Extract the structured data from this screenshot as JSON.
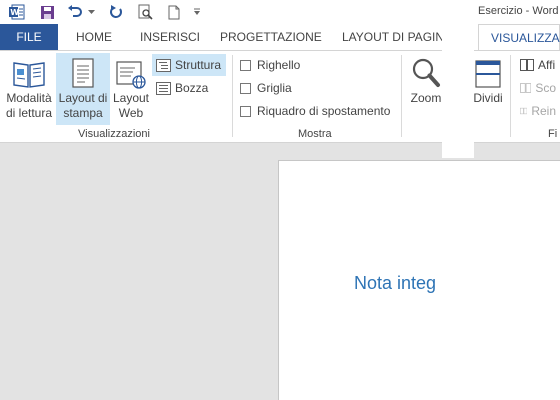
{
  "window": {
    "title": "Esercizio - Word"
  },
  "qat": {
    "icons": [
      "word-logo-icon",
      "save-icon",
      "undo-icon",
      "undo-dropdown-icon",
      "redo-icon",
      "print-preview-icon",
      "new-document-icon",
      "customize-qat-icon"
    ]
  },
  "tabs": {
    "file": "FILE",
    "home": "HOME",
    "insert": "INSERISCI",
    "design": "PROGETTAZIONE",
    "layout": "LAYOUT DI PAGINA",
    "view": "VISUALIZZA"
  },
  "ribbon": {
    "views": {
      "read_mode_line1": "Modalità",
      "read_mode_line2": "di lettura",
      "print_layout_line1": "Layout di",
      "print_layout_line2": "stampa",
      "web_layout_line1": "Layout",
      "web_layout_line2": "Web",
      "outline": "Struttura",
      "draft": "Bozza",
      "group_label": "Visualizzazioni"
    },
    "show": {
      "ruler": "Righello",
      "gridlines": "Griglia",
      "navigation_pane": "Riquadro di spostamento",
      "group_label": "Mostra"
    },
    "zoom": {
      "label": "Zoom"
    },
    "window": {
      "split": "Dividi",
      "side_by_side": "Affi",
      "sync_scroll": "Sco",
      "reset_position": "Rein",
      "group_label": "Fi"
    }
  },
  "document": {
    "text": "Nota integ"
  },
  "colors": {
    "accent": "#2b579a",
    "selected": "#cde6f7",
    "heading": "#2e74b5"
  }
}
